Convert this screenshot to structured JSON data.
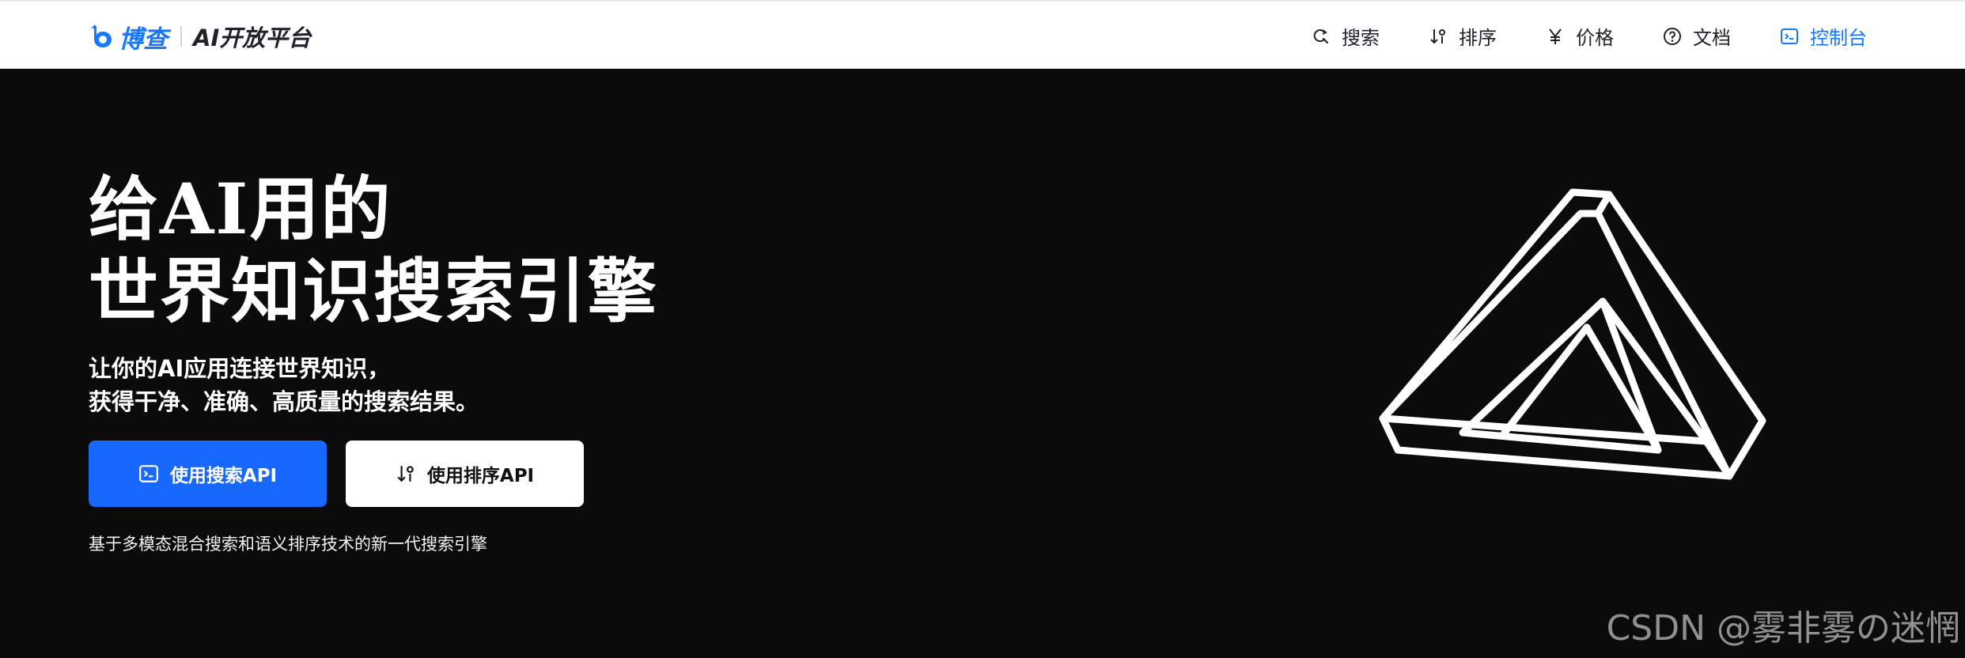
{
  "header": {
    "logo_name": "博查",
    "platform_name": "AI开放平台",
    "nav": [
      {
        "label": "搜索",
        "icon": "search-icon"
      },
      {
        "label": "排序",
        "icon": "sort-icon"
      },
      {
        "label": "价格",
        "icon": "yen-icon"
      },
      {
        "label": "文档",
        "icon": "help-circle-icon"
      },
      {
        "label": "控制台",
        "icon": "terminal-icon",
        "active": true
      }
    ]
  },
  "hero": {
    "title_line1": "给AI用的",
    "title_line2": "世界知识搜索引擎",
    "subtitle_line1": "让你的AI应用连接世界知识，",
    "subtitle_line2": "获得干净、准确、高质量的搜索结果。",
    "primary_button": "使用搜索API",
    "secondary_button": "使用排序API",
    "tagline": "基于多模态混合搜索和语义排序技术的新一代搜索引擎"
  },
  "watermark": "CSDN @雾非雾の迷惘",
  "colors": {
    "brand": "#1677ff",
    "primary_button": "#1668ff",
    "hero_background": "#0b0b0b"
  }
}
